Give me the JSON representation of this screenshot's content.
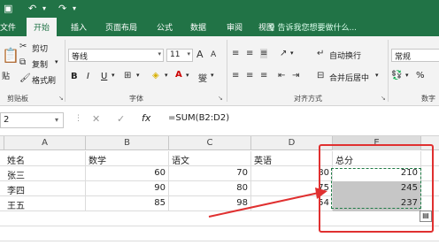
{
  "titlebar": {
    "save_icon": "save-icon",
    "undo_icon": "undo-icon",
    "redo_icon": "redo-icon"
  },
  "tabs": [
    {
      "label": "文件"
    },
    {
      "label": "开始",
      "active": true
    },
    {
      "label": "插入"
    },
    {
      "label": "页面布局"
    },
    {
      "label": "公式"
    },
    {
      "label": "数据"
    },
    {
      "label": "审阅"
    },
    {
      "label": "视图"
    }
  ],
  "tell_me": "告诉我您想要做什么...",
  "ribbon": {
    "clipboard": {
      "paste": "贴",
      "cut": "剪切",
      "copy": "复制",
      "format_painter": "格式刷",
      "group": "剪贴板"
    },
    "font": {
      "name": "等线",
      "size": "11",
      "bold": "B",
      "italic": "I",
      "underline": "U",
      "grow": "A",
      "shrink": "A",
      "group": "字体"
    },
    "alignment": {
      "wrap": "自动换行",
      "merge": "合并后居中",
      "group": "对齐方式"
    },
    "number": {
      "format": "常规",
      "percent": "%",
      "group": "数字"
    }
  },
  "formula_bar": {
    "name_box": "2",
    "fx": "fx",
    "formula": "=SUM(B2:D2)"
  },
  "columns": [
    "A",
    "B",
    "C",
    "D",
    "E"
  ],
  "rows": [
    {
      "a": "姓名",
      "b": "数学",
      "c": "语文",
      "d": "英语",
      "e": "总分"
    },
    {
      "a": "张三",
      "b": "60",
      "c": "70",
      "d": "80",
      "e": "210"
    },
    {
      "a": "李四",
      "b": "90",
      "c": "80",
      "d": "75",
      "e": "245"
    },
    {
      "a": "王五",
      "b": "85",
      "c": "98",
      "d": "54",
      "e": "237"
    }
  ],
  "colors": {
    "excel_green": "#217346",
    "annotation_red": "#e03030",
    "selection_gray": "#c6c6c6"
  }
}
